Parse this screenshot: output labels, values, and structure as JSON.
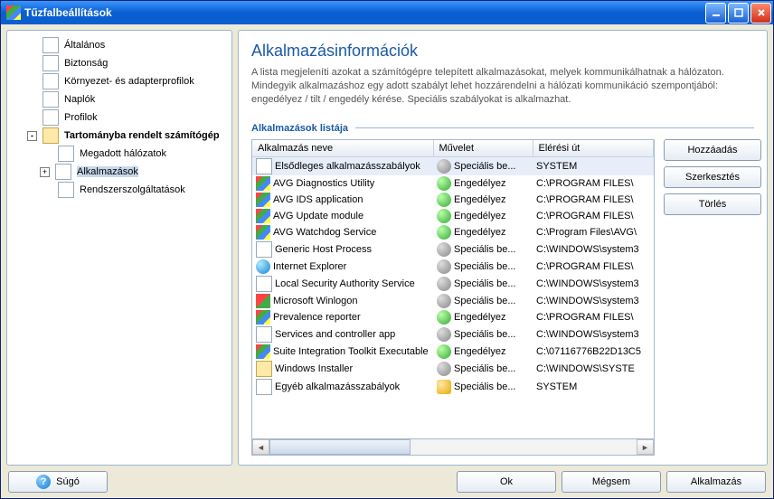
{
  "window": {
    "title": "Tűzfalbeállítások"
  },
  "tree": {
    "items": [
      {
        "label": "Általános"
      },
      {
        "label": "Biztonság"
      },
      {
        "label": "Környezet- és adapterprofilok"
      },
      {
        "label": "Naplók"
      },
      {
        "label": "Profilok"
      },
      {
        "label": "Tartományba rendelt számítógép"
      },
      {
        "label": "Megadott hálózatok"
      },
      {
        "label": "Alkalmazások"
      },
      {
        "label": "Rendszerszolgáltatások"
      }
    ]
  },
  "content": {
    "heading": "Alkalmazásinformációk",
    "description": "A lista megjeleníti azokat a számítógépre telepített alkalmazásokat, melyek kommunikálhatnak a hálózaton. Mindegyik alkalmazáshoz egy adott szabályt lehet hozzárendelni a hálózati kommunikáció szempontjából: engedélyez / tilt / engedély kérése. Speciális szabályokat is alkalmazhat.",
    "subheading": "Alkalmazások listája",
    "columns": {
      "c0": "Alkalmazás neve",
      "c1": "Művelet",
      "c2": "Elérési út"
    },
    "rows": [
      {
        "icon": "rule-icon",
        "name": "Elsődleges alkalmazásszabályok",
        "actIcon": "gear",
        "action": "Speciális be...",
        "path": "SYSTEM"
      },
      {
        "icon": "avg-icon",
        "name": "AVG Diagnostics Utility",
        "actIcon": "allow",
        "action": "Engedélyez",
        "path": "C:\\PROGRAM FILES\\"
      },
      {
        "icon": "avg-icon",
        "name": "AVG IDS application",
        "actIcon": "allow",
        "action": "Engedélyez",
        "path": "C:\\PROGRAM FILES\\"
      },
      {
        "icon": "avg-icon",
        "name": "AVG Update module",
        "actIcon": "allow",
        "action": "Engedélyez",
        "path": "C:\\PROGRAM FILES\\"
      },
      {
        "icon": "avg-icon",
        "name": "AVG Watchdog Service",
        "actIcon": "allow",
        "action": "Engedélyez",
        "path": "C:\\Program Files\\AVG\\"
      },
      {
        "icon": "app-icon",
        "name": "Generic Host Process",
        "actIcon": "gear",
        "action": "Speciális be...",
        "path": "C:\\WINDOWS\\system3"
      },
      {
        "icon": "ie-icon",
        "name": "Internet Explorer",
        "actIcon": "gear",
        "action": "Speciális be...",
        "path": "C:\\PROGRAM FILES\\"
      },
      {
        "icon": "app-icon",
        "name": "Local Security Authority Service",
        "actIcon": "gear",
        "action": "Speciális be...",
        "path": "C:\\WINDOWS\\system3"
      },
      {
        "icon": "win-icon",
        "name": "Microsoft Winlogon",
        "actIcon": "gear",
        "action": "Speciális be...",
        "path": "C:\\WINDOWS\\system3"
      },
      {
        "icon": "avg-icon",
        "name": "Prevalence reporter",
        "actIcon": "allow",
        "action": "Engedélyez",
        "path": "C:\\PROGRAM FILES\\"
      },
      {
        "icon": "app-icon",
        "name": "Services and controller app",
        "actIcon": "gear",
        "action": "Speciális be...",
        "path": "C:\\WINDOWS\\system3"
      },
      {
        "icon": "avg-icon",
        "name": "Suite Integration Toolkit Executable",
        "actIcon": "allow",
        "action": "Engedélyez",
        "path": "C:\\07116776B22D13C5"
      },
      {
        "icon": "wininst-icon",
        "name": "Windows Installer",
        "actIcon": "gear",
        "action": "Speciális be...",
        "path": "C:\\WINDOWS\\SYSTE"
      },
      {
        "icon": "rule-icon",
        "name": "Egyéb alkalmazásszabályok",
        "actIcon": "ask",
        "action": "Speciális be...",
        "path": "SYSTEM"
      }
    ],
    "buttons": {
      "add": "Hozzáadás",
      "edit": "Szerkesztés",
      "delete": "Törlés"
    }
  },
  "footer": {
    "help": "Súgó",
    "ok": "Ok",
    "cancel": "Mégsem",
    "apply": "Alkalmazás"
  }
}
